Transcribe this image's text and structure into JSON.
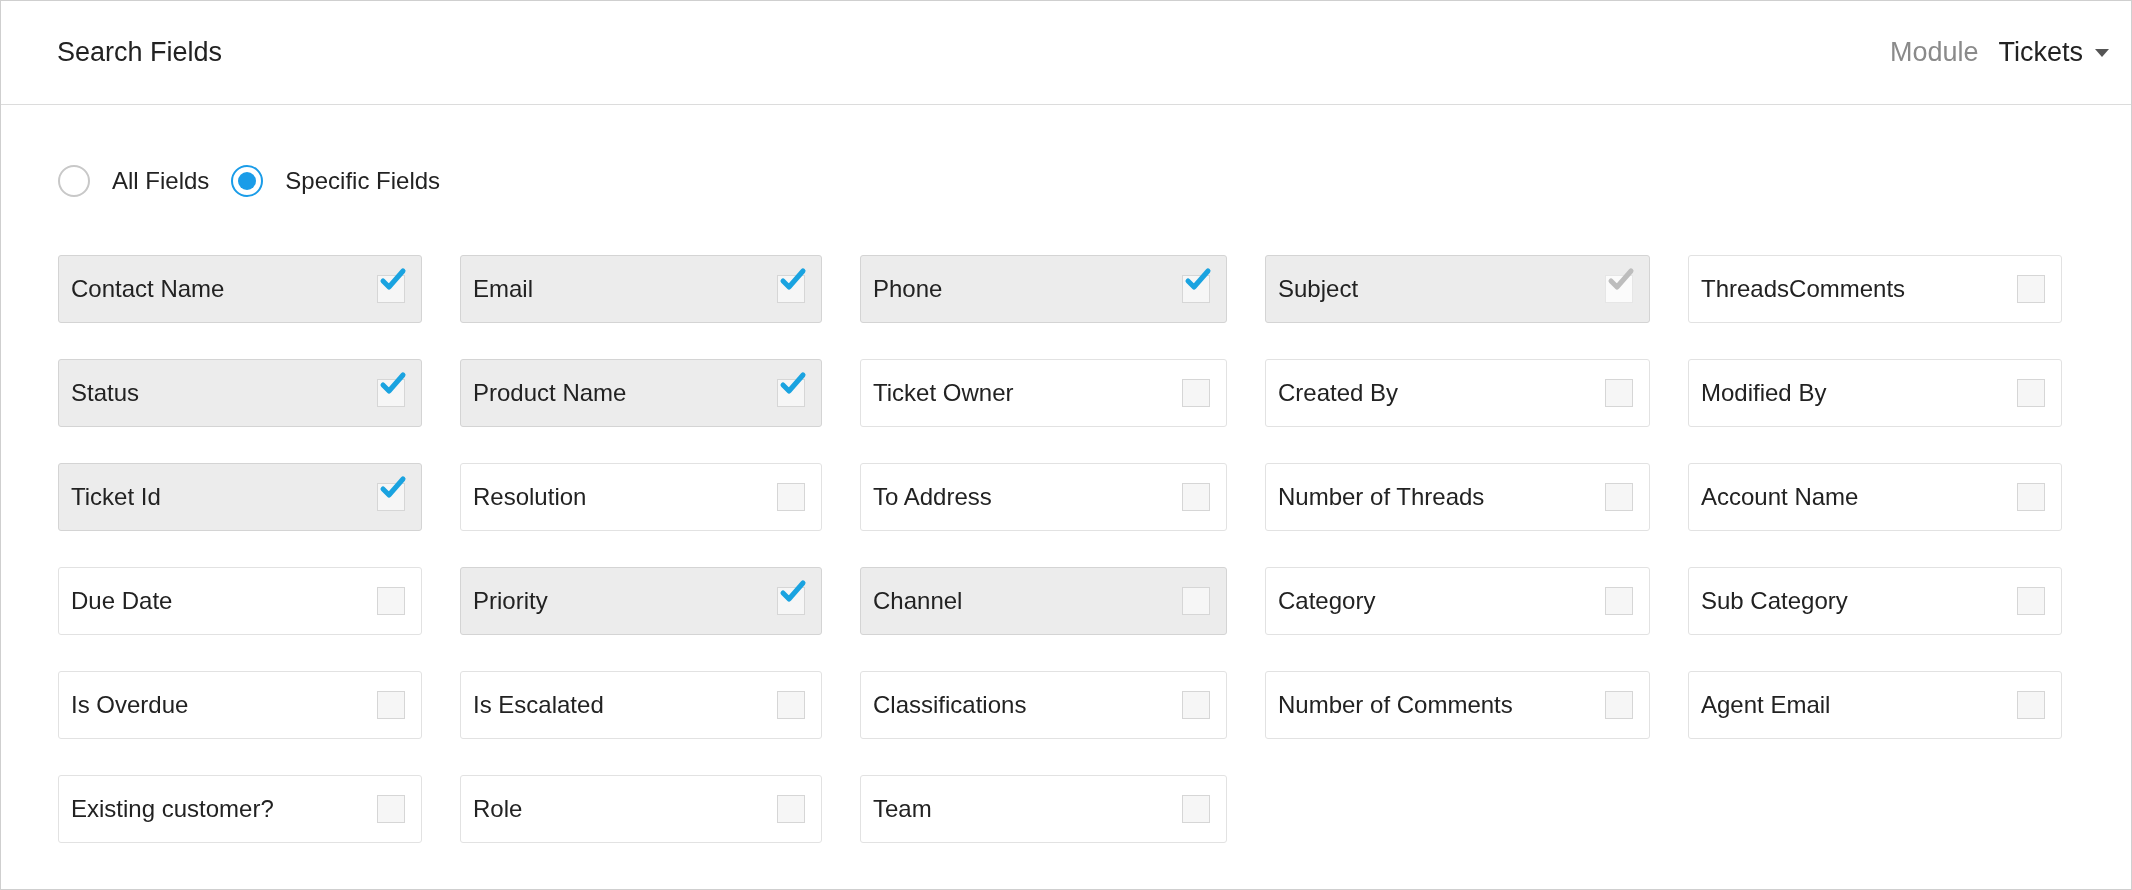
{
  "header": {
    "title": "Search Fields",
    "module_label": "Module",
    "module_value": "Tickets"
  },
  "scope": [
    {
      "label": "All Fields",
      "selected": false
    },
    {
      "label": "Specific Fields",
      "selected": true
    }
  ],
  "fields": [
    {
      "label": "Contact Name",
      "checked": true,
      "disabled": false,
      "shaded": true
    },
    {
      "label": "Email",
      "checked": true,
      "disabled": false,
      "shaded": true
    },
    {
      "label": "Phone",
      "checked": true,
      "disabled": false,
      "shaded": true
    },
    {
      "label": "Subject",
      "checked": true,
      "disabled": true,
      "shaded": true
    },
    {
      "label": "ThreadsComments",
      "checked": false,
      "disabled": false,
      "shaded": false
    },
    {
      "label": "Status",
      "checked": true,
      "disabled": false,
      "shaded": true
    },
    {
      "label": "Product Name",
      "checked": true,
      "disabled": false,
      "shaded": true
    },
    {
      "label": "Ticket Owner",
      "checked": false,
      "disabled": false,
      "shaded": false
    },
    {
      "label": "Created By",
      "checked": false,
      "disabled": false,
      "shaded": false
    },
    {
      "label": "Modified By",
      "checked": false,
      "disabled": false,
      "shaded": false
    },
    {
      "label": "Ticket Id",
      "checked": true,
      "disabled": false,
      "shaded": true
    },
    {
      "label": "Resolution",
      "checked": false,
      "disabled": false,
      "shaded": false
    },
    {
      "label": "To Address",
      "checked": false,
      "disabled": false,
      "shaded": false
    },
    {
      "label": "Number of Threads",
      "checked": false,
      "disabled": false,
      "shaded": false
    },
    {
      "label": "Account Name",
      "checked": false,
      "disabled": false,
      "shaded": false
    },
    {
      "label": "Due Date",
      "checked": false,
      "disabled": false,
      "shaded": false
    },
    {
      "label": "Priority",
      "checked": true,
      "disabled": false,
      "shaded": true
    },
    {
      "label": "Channel",
      "checked": false,
      "disabled": false,
      "shaded": true
    },
    {
      "label": "Category",
      "checked": false,
      "disabled": false,
      "shaded": false
    },
    {
      "label": "Sub Category",
      "checked": false,
      "disabled": false,
      "shaded": false
    },
    {
      "label": "Is Overdue",
      "checked": false,
      "disabled": false,
      "shaded": false
    },
    {
      "label": "Is Escalated",
      "checked": false,
      "disabled": false,
      "shaded": false
    },
    {
      "label": "Classifications",
      "checked": false,
      "disabled": false,
      "shaded": false
    },
    {
      "label": "Number of Comments",
      "checked": false,
      "disabled": false,
      "shaded": false
    },
    {
      "label": "Agent Email",
      "checked": false,
      "disabled": false,
      "shaded": false
    },
    {
      "label": "Existing customer?",
      "checked": false,
      "disabled": false,
      "shaded": false
    },
    {
      "label": "Role",
      "checked": false,
      "disabled": false,
      "shaded": false
    },
    {
      "label": "Team",
      "checked": false,
      "disabled": false,
      "shaded": false
    }
  ]
}
